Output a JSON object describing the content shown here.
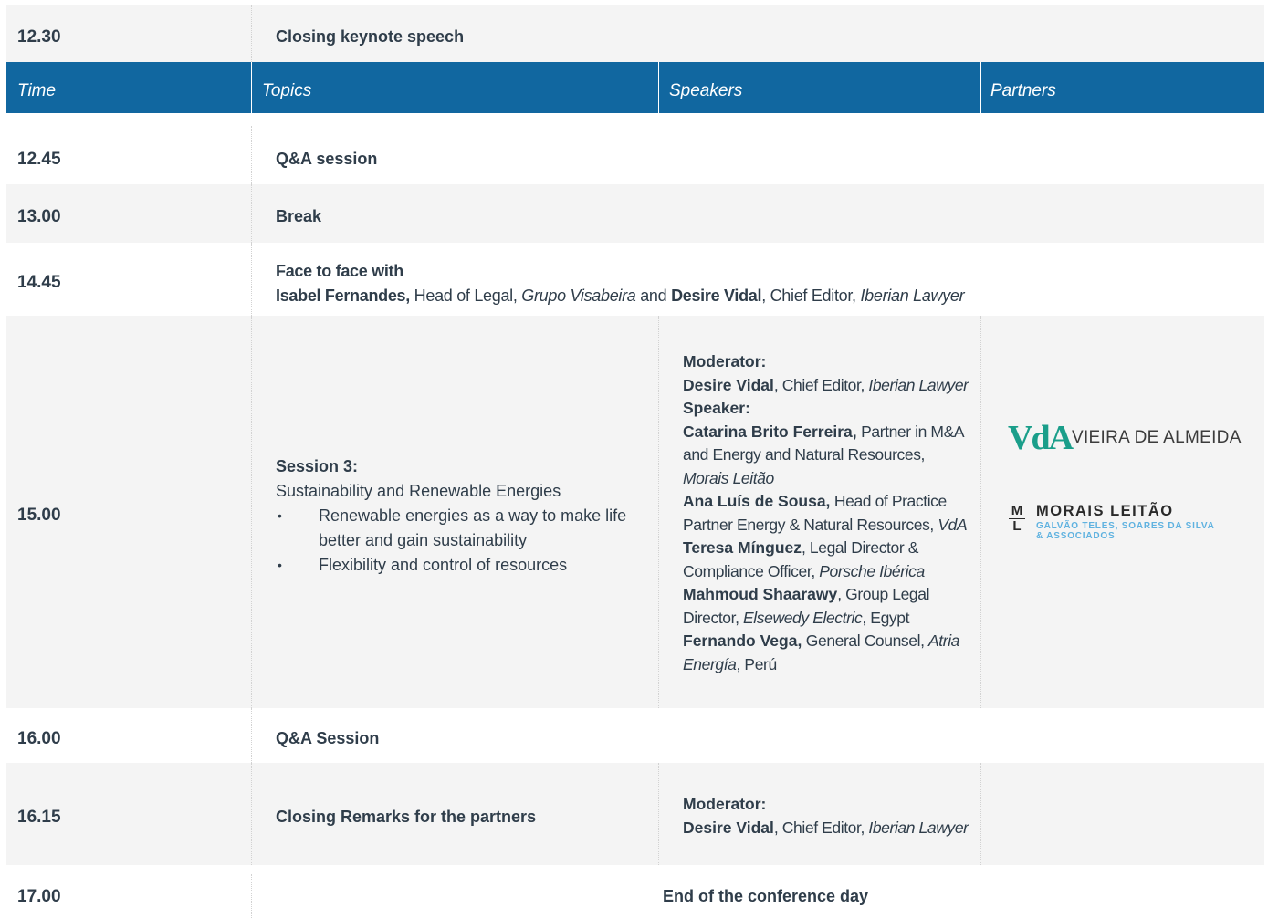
{
  "rows": {
    "r1230": {
      "time": "12.30",
      "topic": "Closing keynote speech"
    },
    "header": {
      "time": "Time",
      "topics": "Topics",
      "speakers": "Speakers",
      "partners": "Partners"
    },
    "r1245": {
      "time": "12.45",
      "topic": "Q&A session"
    },
    "r1300": {
      "time": "13.00",
      "topic": "Break"
    },
    "r1445": {
      "time": "14.45",
      "line1": "Face to face with",
      "p1_name": "Isabel Fernandes,",
      "p1_role": " Head of Legal, ",
      "p1_org": "Grupo Visabeira",
      "and": " and ",
      "p2_name": "Desire Vidal",
      "p2_role": ", Chief Editor, ",
      "p2_org": "Iberian Lawyer"
    },
    "r1500": {
      "time": "15.00",
      "session_title": "Session 3:",
      "session_subtitle": "Sustainability and Renewable Energies",
      "bullets": [
        "Renewable energies as a way to make life better and gain sustainability",
        "Flexibility and control of resources"
      ],
      "moderator_label": "Moderator:",
      "moderator_name": "Desire Vidal",
      "moderator_role": ", Chief Editor, ",
      "moderator_org": "Iberian Lawyer",
      "speaker_label": "Speaker:",
      "s1_name": "Catarina Brito Ferreira,",
      "s1_role": " Partner in M&A and Energy and Natural Resources,",
      "s1_org": "Morais Leitão",
      "s2_name": "Ana Luís de Sousa,",
      "s2_role": " Head of Practice Partner Energy & Natural Resources, ",
      "s2_org": "VdA",
      "s3_name": "Teresa Mínguez",
      "s3_role": ", Legal Director & Compliance Officer, ",
      "s3_org": "Porsche Ibérica",
      "s4_name": "Mahmoud Shaarawy",
      "s4_role": ", Group Legal Director, ",
      "s4_org": "Elsewedy Electric",
      "s4_country": ", Egypt",
      "s5_name": "Fernando Vega,",
      "s5_role": " General Counsel, ",
      "s5_org": "Atria Energía",
      "s5_country": ", Perú",
      "partner1_mark": "VdA",
      "partner1_name": "VIEIRA DE ALMEIDA",
      "partner2_mark_top": "M",
      "partner2_mark_bottom": "L",
      "partner2_name": "MORAIS LEITÃO",
      "partner2_sub1": "GALVÃO TELES, SOARES DA SILVA",
      "partner2_sub2": "& ASSOCIADOS"
    },
    "r1600": {
      "time": "16.00",
      "topic": "Q&A Session"
    },
    "r1615": {
      "time": "16.15",
      "topic": "Closing Remarks for the partners",
      "moderator_label": "Moderator:",
      "moderator_name": "Desire Vidal",
      "moderator_role": ", Chief Editor, ",
      "moderator_org": "Iberian Lawyer"
    },
    "r1700": {
      "time": "17.00",
      "topic": "End of the conference day"
    }
  },
  "colors": {
    "header_bg": "#1167a0",
    "text": "#2f3d4a",
    "alt_row": "#f4f4f4",
    "vda_green": "#1a9e8a",
    "ml_blue": "#5fb2e0"
  }
}
